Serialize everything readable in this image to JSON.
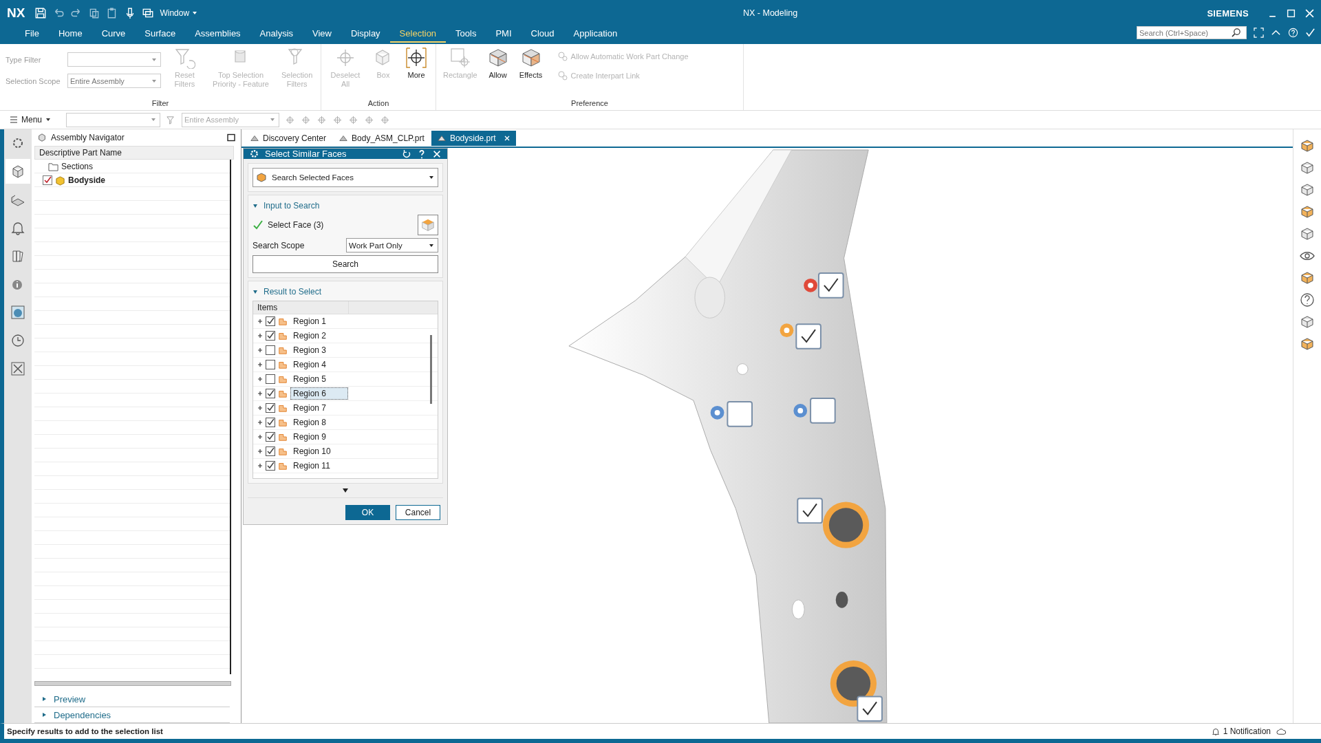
{
  "title_bar": {
    "app_logo": "NX",
    "window_menu": "Window",
    "title": "NX - Modeling",
    "brand": "SIEMENS"
  },
  "menu_tabs": [
    {
      "label": "File",
      "selected": false
    },
    {
      "label": "Home",
      "selected": false
    },
    {
      "label": "Curve",
      "selected": false
    },
    {
      "label": "Surface",
      "selected": false
    },
    {
      "label": "Assemblies",
      "selected": false
    },
    {
      "label": "Analysis",
      "selected": false
    },
    {
      "label": "View",
      "selected": false
    },
    {
      "label": "Display",
      "selected": false
    },
    {
      "label": "Selection",
      "selected": true
    },
    {
      "label": "Tools",
      "selected": false
    },
    {
      "label": "PMI",
      "selected": false
    },
    {
      "label": "Cloud",
      "selected": false
    },
    {
      "label": "Application",
      "selected": false
    }
  ],
  "search": {
    "placeholder": "Search (Ctrl+Space)"
  },
  "ribbon": {
    "filter": {
      "label": "Filter",
      "type_filter_label": "Type Filter",
      "scope_label": "Selection Scope",
      "scope_value": "Entire Assembly",
      "buttons": [
        {
          "label": "Reset Filters",
          "kind": "reset",
          "disabled": true
        },
        {
          "label": "Top Selection Priority - Feature",
          "kind": "priority",
          "disabled": true
        },
        {
          "label": "Selection Filters",
          "kind": "filters",
          "disabled": true
        }
      ]
    },
    "action": {
      "label": "Action",
      "buttons": [
        {
          "label": "Deselect All",
          "kind": "deselect",
          "disabled": true
        },
        {
          "label": "Box",
          "kind": "box",
          "disabled": true
        },
        {
          "label": "More",
          "kind": "more",
          "disabled": false
        }
      ]
    },
    "preference": {
      "label": "Preference",
      "buttons": [
        {
          "label": "Rectangle",
          "kind": "rectangle",
          "disabled": true
        },
        {
          "label": "Allow",
          "kind": "allow",
          "disabled": false
        },
        {
          "label": "Effects",
          "kind": "effects",
          "disabled": false
        }
      ],
      "small_buttons": [
        {
          "label": "Allow Automatic Work Part Change",
          "disabled": true
        },
        {
          "label": "Create Interpart Link",
          "disabled": true
        }
      ]
    }
  },
  "quick_bar": {
    "menu": "Menu",
    "scope": "Entire Assembly"
  },
  "navigator": {
    "title": "Assembly Navigator",
    "column": "Descriptive Part Name",
    "nodes": [
      {
        "label": "Sections",
        "kind": "folder"
      },
      {
        "label": "Bodyside",
        "kind": "part",
        "checked": true
      }
    ],
    "sections": [
      {
        "label": "Preview",
        "expanded": false
      },
      {
        "label": "Dependencies",
        "expanded": false
      }
    ]
  },
  "doc_tabs": [
    {
      "label": "Discovery Center",
      "selected": false
    },
    {
      "label": "Body_ASM_CLP.prt",
      "selected": false
    },
    {
      "label": "Bodyside.prt",
      "selected": true
    }
  ],
  "dialog": {
    "title": "Select Similar Faces",
    "method": "Search Selected Faces",
    "input_section": {
      "label": "Input to Search",
      "expanded": true
    },
    "select_face": "Select Face (3)",
    "scope_label": "Search Scope",
    "scope_value": "Work Part Only",
    "search_button": "Search",
    "result_section": {
      "label": "Result to Select",
      "expanded": true
    },
    "column": "Items",
    "rows": [
      {
        "label": "Region 1",
        "checked": true,
        "selected": false
      },
      {
        "label": "Region 2",
        "checked": true,
        "selected": false
      },
      {
        "label": "Region 3",
        "checked": false,
        "selected": false
      },
      {
        "label": "Region 4",
        "checked": false,
        "selected": false
      },
      {
        "label": "Region 5",
        "checked": false,
        "selected": false
      },
      {
        "label": "Region 6",
        "checked": true,
        "selected": true
      },
      {
        "label": "Region 7",
        "checked": true,
        "selected": false
      },
      {
        "label": "Region 8",
        "checked": true,
        "selected": false
      },
      {
        "label": "Region 9",
        "checked": true,
        "selected": false
      },
      {
        "label": "Region 10",
        "checked": true,
        "selected": false
      },
      {
        "label": "Region 11",
        "checked": true,
        "selected": false
      }
    ],
    "ok": "OK",
    "cancel": "Cancel"
  },
  "viewport_markers": [
    {
      "checked": true
    },
    {
      "checked": true
    },
    {
      "checked": false
    },
    {
      "checked": false
    },
    {
      "checked": true
    },
    {
      "checked": true
    }
  ],
  "status_bar": {
    "message": "Specify results to add to the selection list",
    "notification": "1 Notification"
  }
}
